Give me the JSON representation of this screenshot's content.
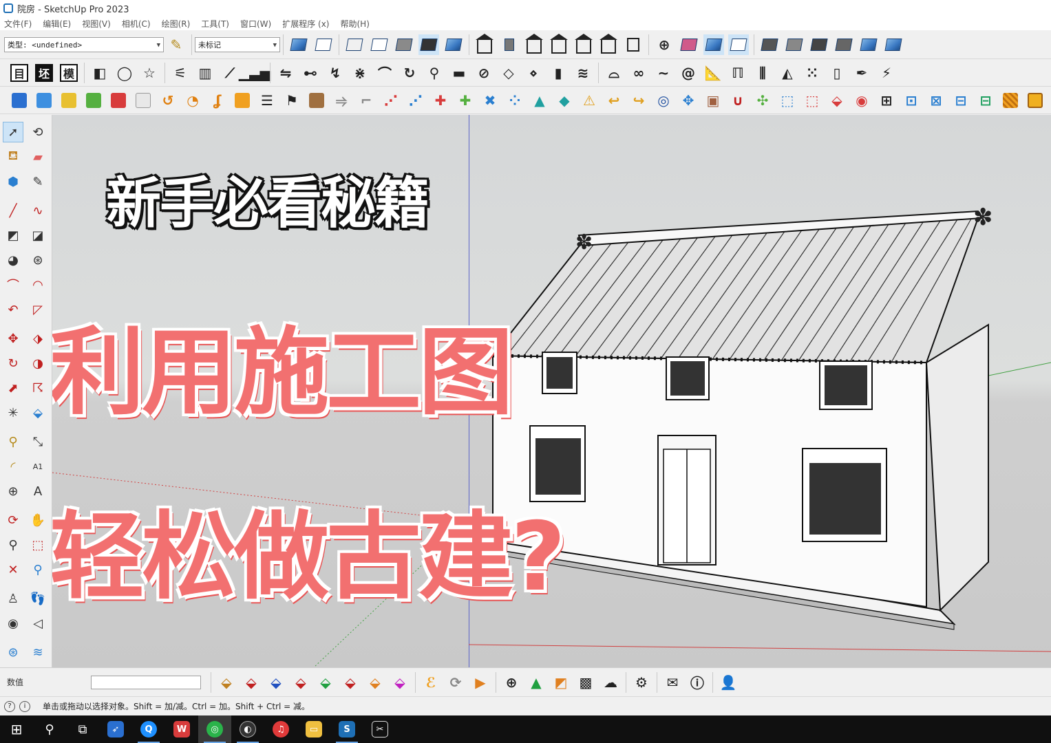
{
  "window": {
    "title": "院房 - SketchUp Pro 2023"
  },
  "menu": [
    "文件(F)",
    "编辑(E)",
    "视图(V)",
    "相机(C)",
    "绘图(R)",
    "工具(T)",
    "窗口(W)",
    "扩展程序 (x)",
    "帮助(H)"
  ],
  "toolbar": {
    "type_dropdown": "类型: <undefined>",
    "tag_dropdown": "未标记",
    "row2_boxed": [
      "目",
      "坯",
      "模"
    ]
  },
  "overlay": {
    "headline1": "新手必看秘籍",
    "headline2": "利用施工图",
    "headline3": "轻松做古建?"
  },
  "measurements": {
    "label": "数值",
    "value": ""
  },
  "status": {
    "hint": "单击或拖动以选择对象。Shift = 加/减。Ctrl = 加。Shift + Ctrl = 减。"
  },
  "colors": {
    "accent": "#1e6fb5",
    "headline_red": "#f27070",
    "axis_blue": "#5b64c8",
    "axis_red": "#d04040",
    "axis_green": "#40a040"
  }
}
